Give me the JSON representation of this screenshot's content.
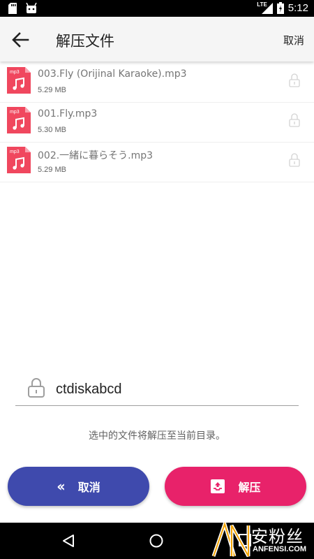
{
  "status_bar": {
    "network": "LTE",
    "time": "5:12"
  },
  "app_bar": {
    "title": "解压文件",
    "cancel_label": "取消"
  },
  "files": [
    {
      "name": "003.Fly (Orijinal Karaoke).mp3",
      "size": "5.29 MB",
      "icon_label": "mp3"
    },
    {
      "name": "001.Fly.mp3",
      "size": "5.30 MB",
      "icon_label": "mp3"
    },
    {
      "name": "002.一緒に暮らそう.mp3",
      "size": "5.29 MB",
      "icon_label": "mp3"
    }
  ],
  "password": {
    "value": "ctdiskabcd"
  },
  "hint": "选中的文件将解压至当前目录。",
  "buttons": {
    "cancel_label": "取消",
    "extract_label": "解压"
  },
  "watermark": {
    "chinese": "安粉丝",
    "english": "ANFENSI.COM"
  },
  "colors": {
    "cancel_button": "#3f4aad",
    "extract_button": "#e8226a",
    "file_icon": "#f0475e"
  }
}
